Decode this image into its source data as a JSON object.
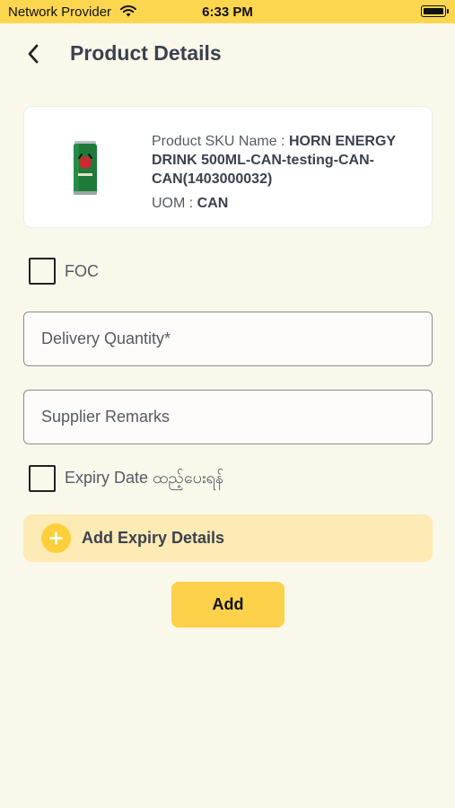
{
  "status_bar": {
    "carrier": "Network Provider",
    "time": "6:33 PM"
  },
  "header": {
    "title": "Product Details",
    "back_icon": "chevron-left-icon"
  },
  "product": {
    "sku_label": "Product SKU Name : ",
    "sku_name": "HORN ENERGY DRINK 500ML-CAN-testing-CAN-CAN(1403000032)",
    "uom_label": "UOM : ",
    "uom_value": "CAN"
  },
  "foc": {
    "label": "FOC",
    "checked": false
  },
  "delivery_quantity": {
    "placeholder": "Delivery Quantity*",
    "value": ""
  },
  "supplier_remarks": {
    "placeholder": "Supplier Remarks",
    "value": ""
  },
  "expiry_date": {
    "label": "Expiry Date ထည့်ပေးရန်",
    "checked": false
  },
  "add_expiry": {
    "label": "Add Expiry Details",
    "icon": "plus-icon"
  },
  "add_button": {
    "label": "Add"
  },
  "colors": {
    "accent": "#fdd64f",
    "background": "#faf8ea",
    "expiry_panel": "#fdeab4",
    "text": "#3c4150"
  }
}
